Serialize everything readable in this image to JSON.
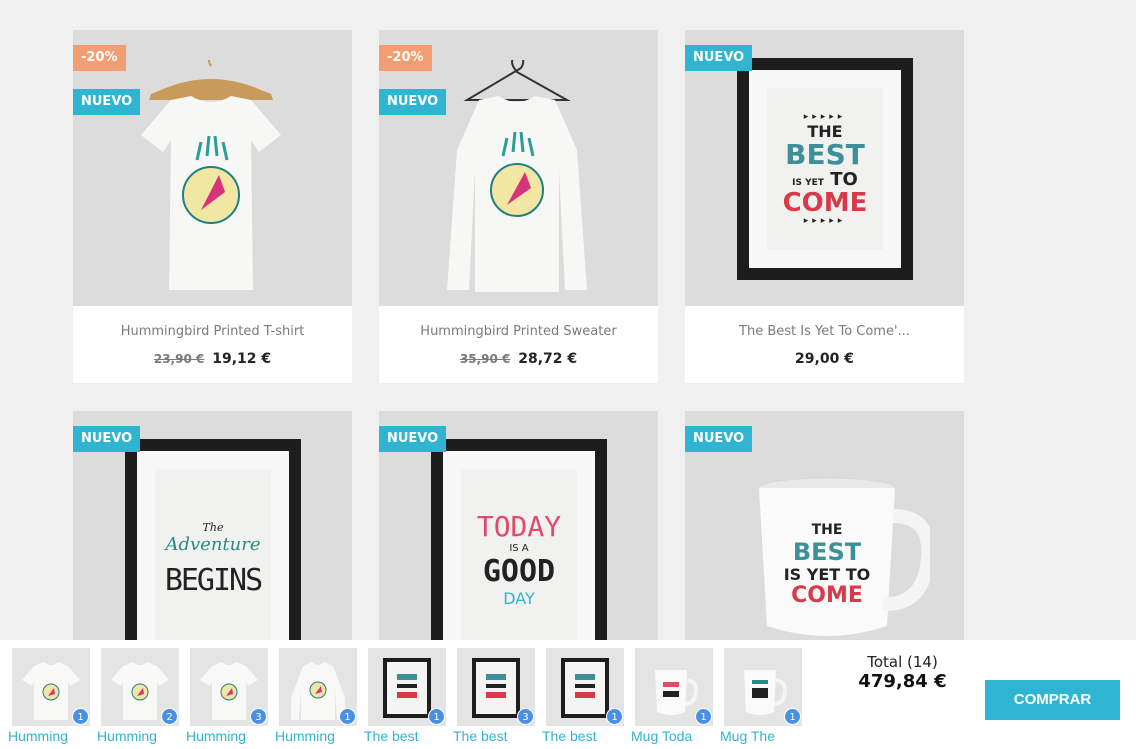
{
  "colors": {
    "flag_new": "#2fb5d2",
    "flag_discount": "#f39d72",
    "accent": "#2fb5d2"
  },
  "products": [
    {
      "flags": [
        "-20%",
        "NUEVO"
      ],
      "name": "Hummingbird Printed T-shirt",
      "old_price": "23,90 €",
      "price": "19,12 €",
      "image": "tshirt"
    },
    {
      "flags": [
        "-20%",
        "NUEVO"
      ],
      "name": "Hummingbird Printed Sweater",
      "old_price": "35,90 €",
      "price": "28,72 €",
      "image": "sweater"
    },
    {
      "flags": [
        "NUEVO"
      ],
      "name": "The Best Is Yet To Come'...",
      "old_price": "",
      "price": "29,00 €",
      "image": "poster-best"
    },
    {
      "flags": [
        "NUEVO"
      ],
      "name": "",
      "old_price": "",
      "price": "",
      "image": "poster-adventure"
    },
    {
      "flags": [
        "NUEVO"
      ],
      "name": "",
      "old_price": "",
      "price": "",
      "image": "poster-today"
    },
    {
      "flags": [
        "NUEVO"
      ],
      "name": "",
      "old_price": "",
      "price": "",
      "image": "mug-best"
    }
  ],
  "posters": {
    "best": {
      "line1": "THE",
      "line2": "BEST",
      "line3": "IS YET",
      "line4": "TO",
      "line5": "COME"
    },
    "adventure": {
      "line1": "The",
      "line2": "Adventure",
      "line3": "BEGINS"
    },
    "today": {
      "line1": "TODAY",
      "line2": "IS A",
      "line3": "GOOD",
      "line4": "DAY"
    }
  },
  "cart_bar": {
    "items": [
      {
        "label": "Humming",
        "qty": "1",
        "image": "tshirt"
      },
      {
        "label": "Humming",
        "qty": "2",
        "image": "tshirt"
      },
      {
        "label": "Humming",
        "qty": "3",
        "image": "tshirt"
      },
      {
        "label": "Humming",
        "qty": "1",
        "image": "tshirt"
      },
      {
        "label": "The best",
        "qty": "1",
        "image": "poster"
      },
      {
        "label": "The best",
        "qty": "3",
        "image": "poster"
      },
      {
        "label": "The best",
        "qty": "1",
        "image": "poster"
      },
      {
        "label": "Mug Toda",
        "qty": "1",
        "image": "mug"
      },
      {
        "label": "Mug The",
        "qty": "1",
        "image": "mug"
      }
    ],
    "total_label": "Total (14)",
    "total_amount": "479,84 €",
    "buy_label": "COMPRAR"
  }
}
